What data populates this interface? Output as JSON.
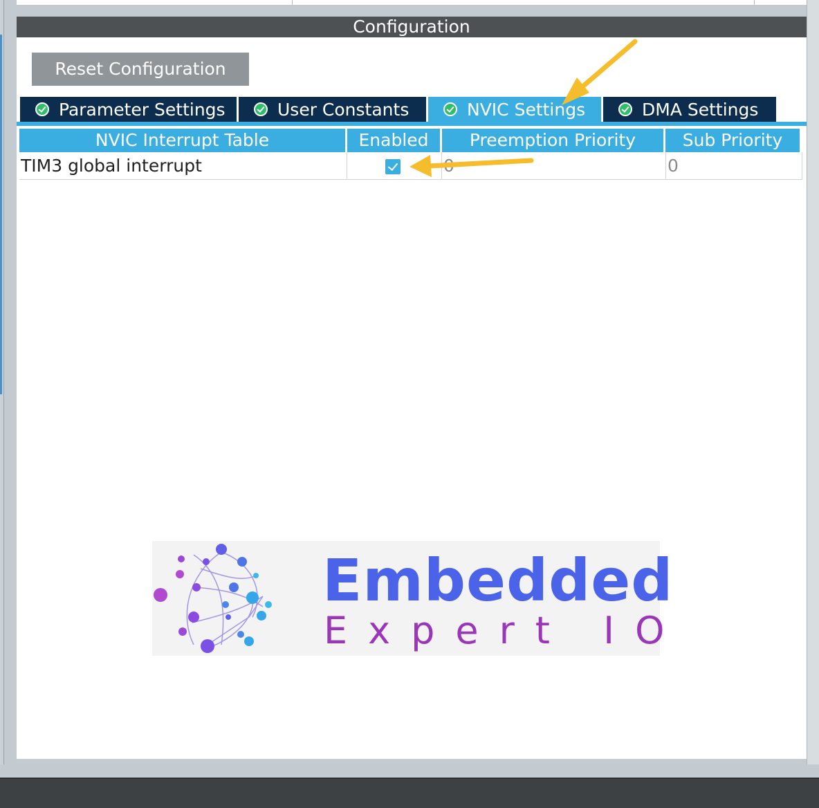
{
  "config": {
    "header_title": "Configuration",
    "reset_label": "Reset Configuration"
  },
  "tabs": [
    {
      "label": "Parameter Settings",
      "active": false
    },
    {
      "label": "User Constants",
      "active": false
    },
    {
      "label": "NVIC Settings",
      "active": true
    },
    {
      "label": "DMA Settings",
      "active": false
    }
  ],
  "table": {
    "headers": [
      "NVIC Interrupt Table",
      "Enabled",
      "Preemption Priority",
      "Sub Priority"
    ],
    "rows": [
      {
        "name": "TIM3 global interrupt",
        "enabled": true,
        "preemption": "0",
        "sub": "0"
      }
    ]
  },
  "logo": {
    "title": "Embedded",
    "subtitle": "Expert IO"
  },
  "colors": {
    "tab_dark": "#0c2d4d",
    "tab_active": "#3aaee0",
    "header_bg": "#4d5154",
    "arrow": "#f5bd2b",
    "logo_blue": "#4b63e8",
    "logo_purple": "#9a36b8"
  }
}
